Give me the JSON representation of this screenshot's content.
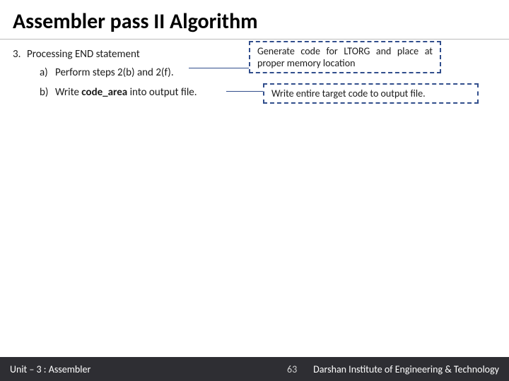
{
  "title": "Assembler pass II Algorithm",
  "list": {
    "num3": "3.",
    "text3": "Processing END statement",
    "sub_a_lbl": "a)",
    "sub_a_text": "Perform steps 2(b) and 2(f).",
    "sub_b_lbl": "b)",
    "sub_b_text_pre": "Write ",
    "sub_b_bold": "code_area",
    "sub_b_text_post": " into output file."
  },
  "callouts": {
    "c1": "Generate code for LTORG and place at proper memory location",
    "c2": "Write entire target code to output file."
  },
  "footer": {
    "left": "Unit – 3  : Assembler",
    "page": "63",
    "right": "Darshan Institute of Engineering & Technology"
  }
}
